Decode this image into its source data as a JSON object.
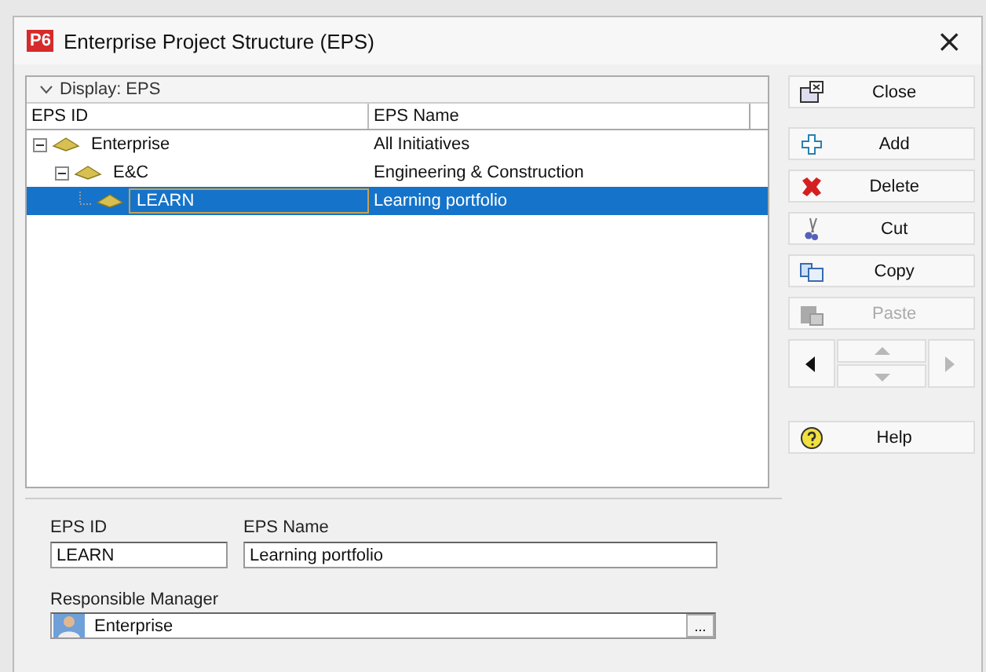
{
  "window": {
    "logo": "P6",
    "title": "Enterprise Project Structure (EPS)",
    "close": "×"
  },
  "tree": {
    "display_label": "Display: EPS",
    "columns": [
      "EPS ID",
      "EPS Name"
    ],
    "rows": [
      {
        "id": "Enterprise",
        "name": "All Initiatives",
        "expanded": true,
        "selected": false,
        "children": [
          {
            "id": "E&C",
            "name": "Engineering & Construction",
            "expanded": true,
            "selected": false,
            "children": [
              {
                "id": "LEARN",
                "name": "Learning portfolio",
                "selected": true
              }
            ]
          }
        ]
      }
    ]
  },
  "buttons": [
    {
      "kind": "close",
      "label": "Close",
      "disabled": false
    },
    {
      "kind": "add",
      "label": "Add",
      "disabled": false
    },
    {
      "kind": "delete",
      "label": "Delete",
      "disabled": false
    },
    {
      "kind": "cut",
      "label": "Cut",
      "disabled": false
    },
    {
      "kind": "copy",
      "label": "Copy",
      "disabled": false
    },
    {
      "kind": "paste",
      "label": "Paste",
      "disabled": true
    },
    {
      "kind": "nav",
      "arrows": [
        {
          "kind": "left",
          "disabled": false
        },
        {
          "kind": "up",
          "disabled": true
        },
        {
          "kind": "down",
          "disabled": true
        },
        {
          "kind": "right",
          "disabled": true
        }
      ]
    },
    {
      "kind": "help",
      "label": "Help",
      "disabled": false
    }
  ],
  "details": {
    "id_label": "EPS ID",
    "id_value": "LEARN",
    "name_label": "EPS Name",
    "name_value": "Learning portfolio",
    "manager_label": "Responsible Manager",
    "manager_value": "Enterprise",
    "browse": "..."
  }
}
